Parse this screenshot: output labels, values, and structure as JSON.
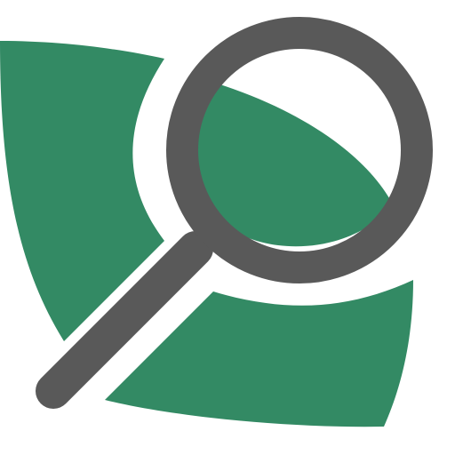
{
  "icon": {
    "name": "leaf-search-icon",
    "colors": {
      "leaf": "#338A64",
      "magnifier": "#595959",
      "background": "#FFFFFF"
    }
  }
}
